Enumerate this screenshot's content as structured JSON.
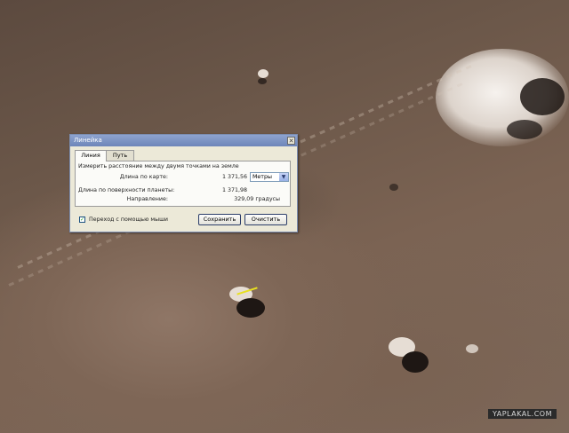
{
  "ruler_dialog": {
    "title": "Линейка",
    "close_symbol": "✕",
    "tabs": [
      {
        "label": "Линия",
        "active": true
      },
      {
        "label": "Путь",
        "active": false
      }
    ],
    "instruction": "Измерить расстояние между двумя точками на земле",
    "map_length_label": "Длина по карте:",
    "map_length_value": "1 371,56",
    "unit_selected": "Метры",
    "surface_length_label": "Длина по поверхности планеты:",
    "surface_length_value": "1 371,98",
    "direction_label": "Направление:",
    "direction_value": "329,09 градусы",
    "mouse_nav_label": "Переход с помощью мыши",
    "mouse_nav_checked": true,
    "save_button": "Сохранить",
    "clear_button": "Очистить"
  },
  "watermark": "YAPLAKAL.COM",
  "colors": {
    "dialog_bg": "#ece9d8",
    "titlebar": "#6d85b9",
    "terrain": "#7b6353"
  }
}
